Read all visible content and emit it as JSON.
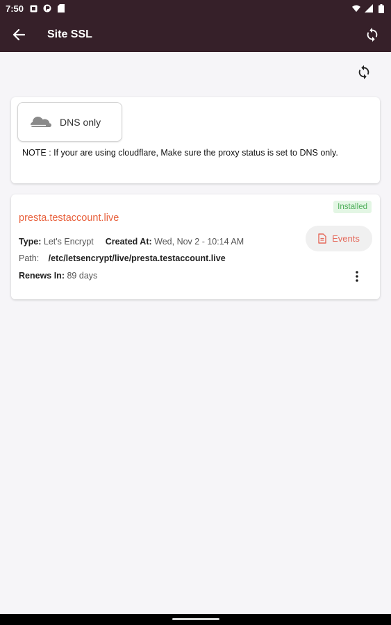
{
  "status_bar": {
    "time": "7:50"
  },
  "app_bar": {
    "title": "Site SSL"
  },
  "dns_card": {
    "chip_label": "DNS only",
    "note": "NOTE : If your are using cloudflare, Make sure the proxy status is set to DNS only."
  },
  "ssl_card": {
    "domain": "presta.testaccount.live",
    "status_badge": "Installed",
    "events_label": "Events",
    "type_label": "Type:",
    "type_value": "Let's Encrypt",
    "created_label": "Created At:",
    "created_value": "Wed, Nov 2 - 10:14 AM",
    "path_label": "Path:",
    "path_value": "/etc/letsencrypt/live/presta.testaccount.live",
    "renews_label": "Renews In:",
    "renews_value": "89 days"
  },
  "colors": {
    "app_bar": "#362029",
    "domain": "#e8603c",
    "badge_bg": "#e3f6e4",
    "badge_text": "#4fae5a",
    "events_text": "#e56a5c"
  },
  "icons": {
    "back": "arrow-left-icon",
    "sync": "sync-icon",
    "refresh": "refresh-icon",
    "cloud": "cloud-icon",
    "document": "document-icon",
    "more": "more-vertical-icon"
  }
}
